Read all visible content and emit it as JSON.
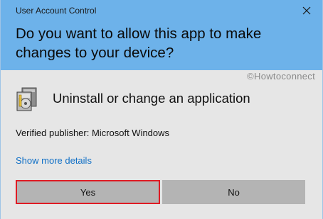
{
  "window": {
    "title": "User Account Control",
    "close_icon": "close-icon"
  },
  "prompt": {
    "question": "Do you want to allow this app to make changes to your device?"
  },
  "watermark": "©Howtoconnect",
  "app": {
    "icon": "application-installer-icon",
    "name": "Uninstall or change an application",
    "publisher": "Verified publisher: Microsoft Windows"
  },
  "links": {
    "show_more_details": "Show more details"
  },
  "buttons": {
    "yes": "Yes",
    "no": "No"
  },
  "colors": {
    "header_bg": "#6db2ea",
    "body_bg": "#e6e6e6",
    "link": "#0f6fc6",
    "button_bg": "#b4b4b4",
    "focus_highlight": "#e01b24"
  }
}
